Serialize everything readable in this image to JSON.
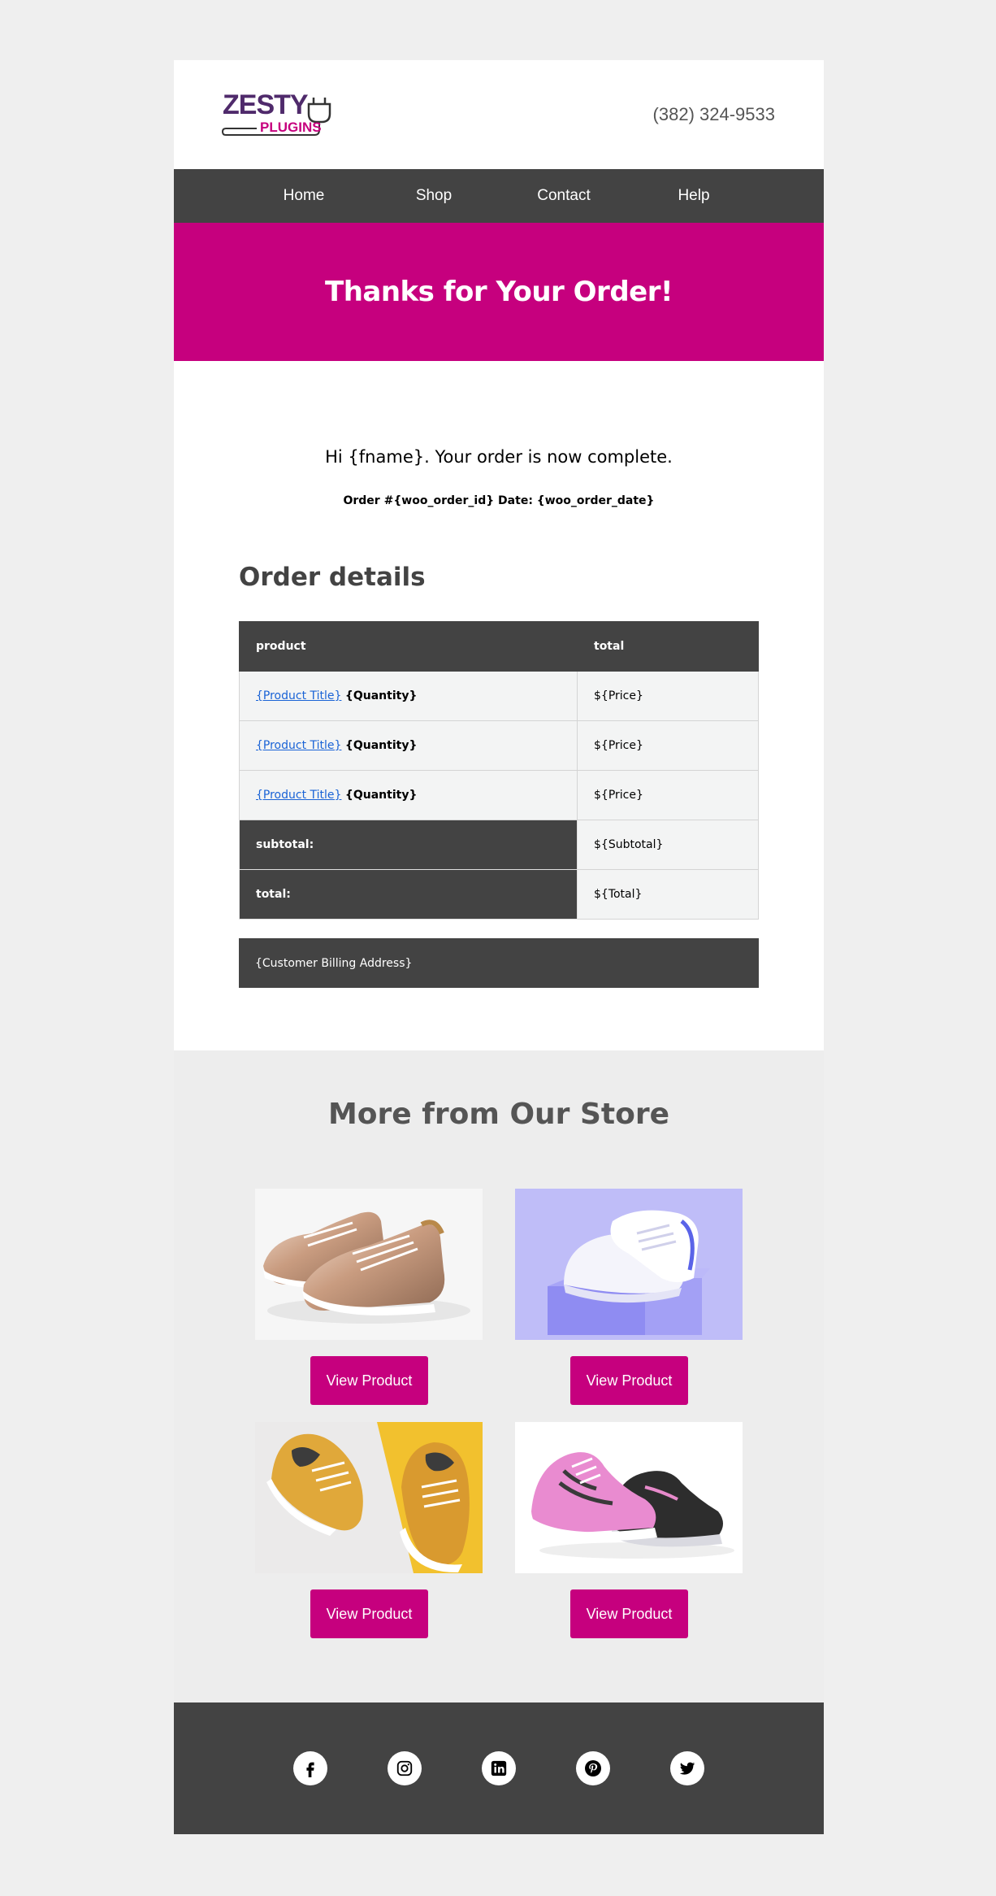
{
  "brand": {
    "name_top": "ZESTY",
    "name_bottom": "PLUGINS",
    "purple": "#4f2a6b",
    "magenta": "#c6007e"
  },
  "header": {
    "phone": "(382) 324-9533"
  },
  "nav": {
    "items": [
      "Home",
      "Shop",
      "Contact",
      "Help"
    ]
  },
  "hero": {
    "title": "Thanks for Your Order!"
  },
  "main": {
    "greeting": "Hi {fname}.  Your order is now complete.",
    "order_meta": "Order #{woo_order_id} Date: {woo_order_date}",
    "section_title": "Order details",
    "table": {
      "headers": [
        "product",
        "total"
      ],
      "rows": [
        {
          "product": "{Product Title}",
          "quantity": "{Quantity}",
          "total": "${Price}"
        },
        {
          "product": "{Product Title}",
          "quantity": "{Quantity}",
          "total": "${Price}"
        },
        {
          "product": "{Product Title}",
          "quantity": "{Quantity}",
          "total": "${Price}"
        }
      ],
      "subtotal_label": "subtotal:",
      "subtotal_value": "${Subtotal}",
      "total_label": "total:",
      "total_value": "${Total}"
    },
    "billing": "{Customer Billing Address}"
  },
  "more": {
    "title": "More from Our Store",
    "products": [
      {
        "image": "metallic-rose-gold-sneakers",
        "button": "View Product"
      },
      {
        "image": "white-sneaker-on-lavender-block",
        "button": "View Product"
      },
      {
        "image": "yellow-canvas-sneakers",
        "button": "View Product"
      },
      {
        "image": "pink-black-running-shoes",
        "button": "View Product"
      }
    ]
  },
  "footer": {
    "social": [
      "facebook-icon",
      "instagram-icon",
      "linkedin-icon",
      "pinterest-icon",
      "twitter-icon"
    ]
  },
  "colors": {
    "dark": "#434343",
    "accent": "#c6007e",
    "link": "#1a63d6"
  }
}
